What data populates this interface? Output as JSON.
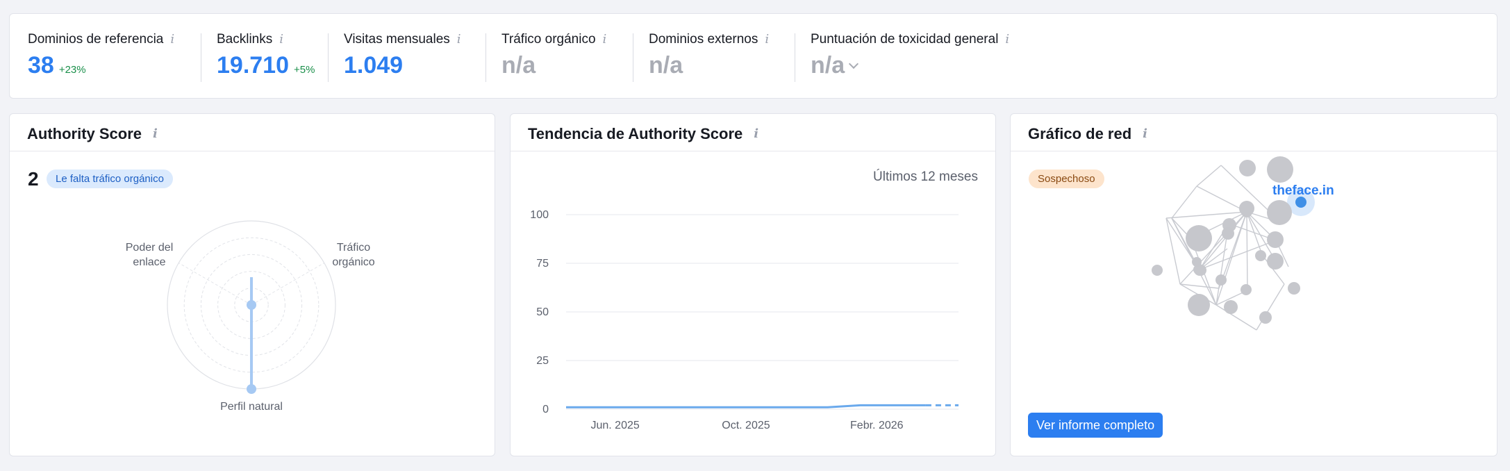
{
  "metrics": {
    "referring_domains": {
      "label": "Dominios de referencia",
      "value": "38",
      "delta": "+23%"
    },
    "backlinks": {
      "label": "Backlinks",
      "value": "19.710",
      "delta": "+5%"
    },
    "monthly_visits": {
      "label": "Visitas mensuales",
      "value": "1.049"
    },
    "organic_traffic": {
      "label": "Tráfico orgánico",
      "value": "n/a"
    },
    "external_domains": {
      "label": "Dominios externos",
      "value": "n/a"
    },
    "toxicity": {
      "label": "Puntuación de toxicidad general",
      "value": "n/a"
    }
  },
  "authority": {
    "title": "Authority Score",
    "score": "2",
    "badge": "Le falta tráfico orgánico",
    "radar_labels": {
      "link_power_line1": "Poder del",
      "link_power_line2": "enlace",
      "organic_traffic_line1": "Tráfico",
      "organic_traffic_line2": "orgánico",
      "natural_profile": "Perfil natural"
    },
    "radar_values": {
      "link_power": 0,
      "organic_traffic": 0,
      "natural_profile": 1.0
    }
  },
  "trend": {
    "title": "Tendencia de Authority Score",
    "period": "Últimos 12 meses"
  },
  "chart_data": {
    "type": "line",
    "title": "Tendencia de Authority Score",
    "xlabel": "",
    "ylabel": "",
    "ylim": [
      0,
      100
    ],
    "yticks": [
      "100",
      "75",
      "50",
      "25",
      "0"
    ],
    "x_tick_labels": [
      "Jun. 2025",
      "Oct. 2025",
      "Febr. 2026"
    ],
    "x": [
      0,
      1,
      2,
      3,
      4,
      5,
      6,
      7,
      8,
      9,
      10,
      11
    ],
    "series": [
      {
        "values": [
          1,
          1,
          1,
          1,
          1,
          1,
          1,
          1,
          1,
          2,
          2,
          2
        ]
      }
    ],
    "projected": [
      {
        "from_x": 11,
        "to_x": 12,
        "value": 2
      }
    ],
    "grid": true,
    "color": "#6aa9ec"
  },
  "network": {
    "title": "Gráfico de red",
    "badge": "Sospechoso",
    "highlight_label": "theface.in",
    "button": "Ver informe completo"
  },
  "colors": {
    "accent": "#2c7ef0",
    "muted": "#a9acb4",
    "delta": "#1a8f4a"
  }
}
